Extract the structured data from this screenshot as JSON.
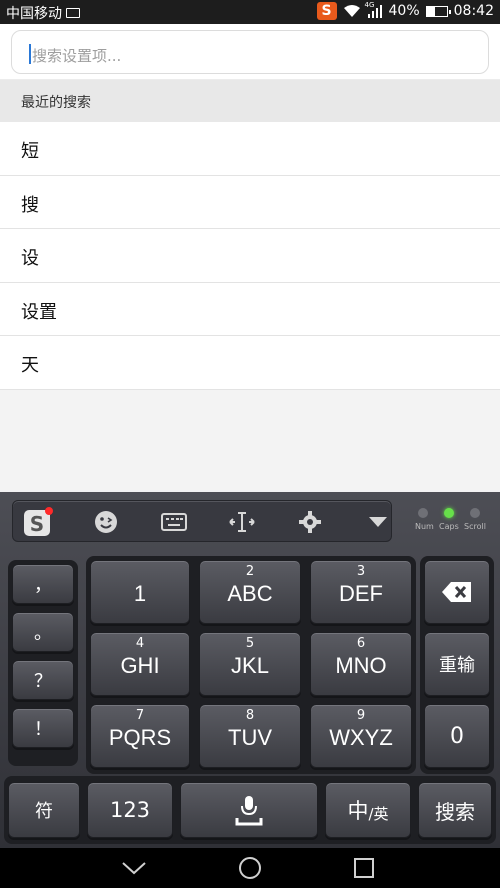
{
  "status_bar": {
    "carrier": "中国移动",
    "network": "4G",
    "battery": "40%",
    "battery_level": 0.4,
    "time": "08:42",
    "ime_badge": "S"
  },
  "search": {
    "placeholder": "搜索设置项..."
  },
  "recent": {
    "header": "最近的搜索",
    "items": [
      "短",
      "搜",
      "设",
      "设置",
      "天"
    ]
  },
  "keyboard": {
    "indicators": [
      "Num",
      "Caps",
      "Scroll"
    ],
    "symbol_keys": [
      "，",
      "。",
      "？",
      "！"
    ],
    "keys": {
      "k1": {
        "num": "",
        "main": "1"
      },
      "k2": {
        "num": "2",
        "main": "ABC"
      },
      "k3": {
        "num": "3",
        "main": "DEF"
      },
      "k4": {
        "num": "4",
        "main": "GHI"
      },
      "k5": {
        "num": "5",
        "main": "JKL"
      },
      "k6": {
        "num": "6",
        "main": "MNO"
      },
      "k7": {
        "num": "7",
        "main": "PQRS"
      },
      "k8": {
        "num": "8",
        "main": "TUV"
      },
      "k9": {
        "num": "9",
        "main": "WXYZ"
      }
    },
    "retype": "重输",
    "zero": "0",
    "bottom": {
      "symbols": "符",
      "numbers": "123",
      "lang_main": "中",
      "lang_sub": "/英",
      "search": "搜索"
    }
  }
}
